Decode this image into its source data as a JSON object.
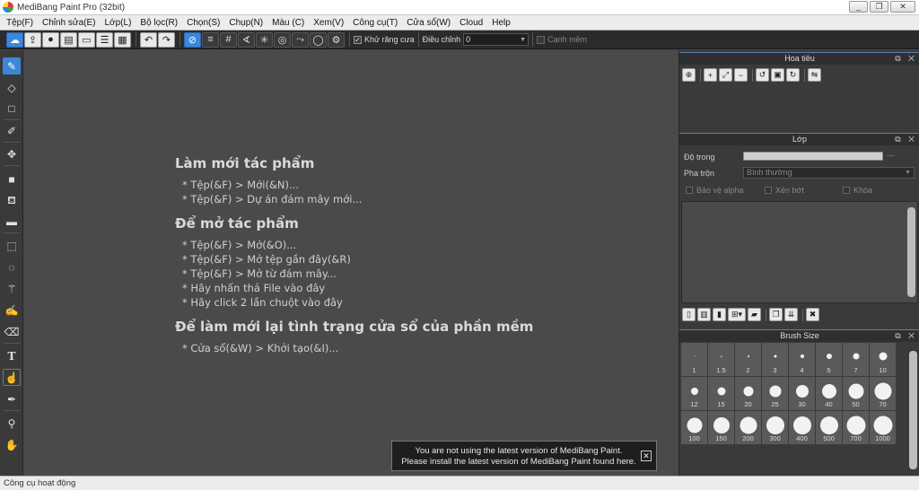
{
  "window": {
    "title": "MediBang Paint Pro (32bit)",
    "min_glyph": "_",
    "max_glyph": "❐",
    "close_glyph": "✕"
  },
  "menu": [
    "Tệp(F)",
    "Chỉnh sửa(E)",
    "Lớp(L)",
    "Bộ lọc(R)",
    "Chọn(S)",
    "Chụp(N)",
    "Màu (C)",
    "Xem(V)",
    "Công cụ(T)",
    "Cửa sổ(W)",
    "Cloud",
    "Help"
  ],
  "toolbar": {
    "antialias_label": "Khử răng cưa",
    "antialias_checked": true,
    "adjust_label": "Điều chỉnh",
    "adjust_value": "0",
    "smooth_edge_label": "Cạnh mềm",
    "smooth_edge_checked": false
  },
  "welcome": {
    "new_heading": "Làm mới tác phẩm",
    "new_items": [
      "* Tệp(&F) > Mới(&N)...",
      "* Tệp(&F) > Dự án đám mây mới..."
    ],
    "open_heading": "Để mở tác phẩm",
    "open_items": [
      "* Tệp(&F) > Mở(&O)...",
      "* Tệp(&F) > Mở tệp gần đây(&R)",
      "* Tệp(&F) > Mở từ đám mây...",
      "* Hãy nhấn thả File vào đây",
      "* Hãy click 2 lần chuột vào đây"
    ],
    "reset_heading": "Để làm mới lại tình trạng cửa sổ của phần mềm",
    "reset_items": [
      "* Cửa sổ(&W) > Khởi tạo(&I)..."
    ]
  },
  "notice": {
    "line1": "You are not using the latest version of MediBang Paint.",
    "line2": "Please install the latest version of MediBang Paint found here.",
    "close_glyph": "✕"
  },
  "navigator": {
    "title": "Hoa tiêu"
  },
  "layer": {
    "title": "Lớp",
    "opacity_label": "Độ trong",
    "opacity_value": "---",
    "blend_label": "Pha trộn",
    "blend_value": "Bình thường",
    "protect_alpha_label": "Bảo vệ alpha",
    "clipping_label": "Xén bớt",
    "lock_label": "Khóa"
  },
  "brush_size": {
    "title": "Brush Size",
    "sizes": [
      "1",
      "1.5",
      "2",
      "3",
      "4",
      "5",
      "7",
      "10",
      "12",
      "15",
      "20",
      "25",
      "30",
      "40",
      "50",
      "70",
      "100",
      "150",
      "200",
      "300",
      "400",
      "500",
      "700",
      "1000"
    ],
    "selected": null
  },
  "panel_icons": "⧉ ✕",
  "status": {
    "text": "Công cụ hoạt động"
  },
  "colors": {
    "accent": "#3d86d9",
    "canvas_bg": "#4a4a4a",
    "panel_bg": "#3a3a3a"
  }
}
